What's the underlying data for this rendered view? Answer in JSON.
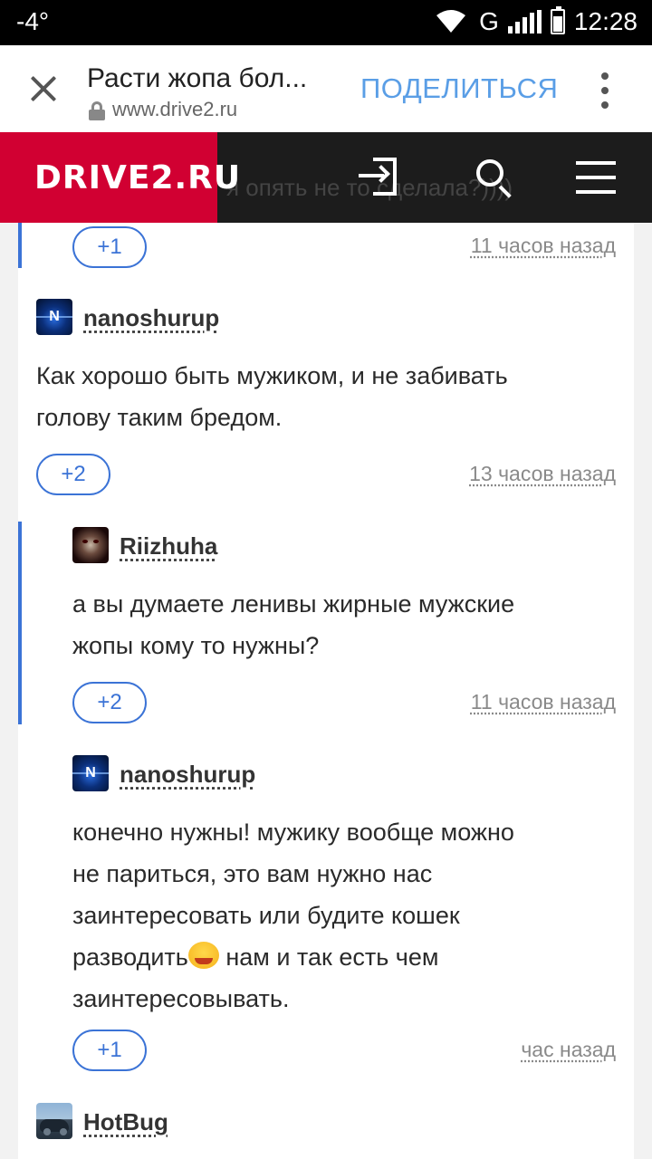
{
  "status_bar": {
    "temperature": "-4°",
    "network": "G",
    "time": "12:28"
  },
  "tab_bar": {
    "title": "Расти жопа бол...",
    "url": "www.drive2.ru",
    "share_label": "ПОДЕЛИТЬСЯ"
  },
  "site_header": {
    "logo": "DRIVE2.RU",
    "behind_text": "я опять не то сделала?))))"
  },
  "comments": [
    {
      "vote": "+1",
      "time": "11 часов назад"
    },
    {
      "author": "nanoshurup",
      "lines": [
        "Как хорошо быть мужиком, и не забивать",
        "голову таким бредом."
      ],
      "vote": "+2",
      "time": "13 часов назад"
    },
    {
      "author": "Riizhuha",
      "lines": [
        "а вы думаете ленивы жирные мужские",
        "жопы кому то нужны?"
      ],
      "vote": "+2",
      "time": "11 часов назад"
    },
    {
      "author": "nanoshurup",
      "lines": [
        "конечно нужны! мужику вообще можно",
        "не париться, это вам нужно нас",
        "заинтересовать или будите кошек",
        "разводить",
        " нам и так есть чем",
        "заинтересовывать."
      ],
      "vote": "+1",
      "time": "час назад"
    },
    {
      "author": "HotBug"
    }
  ],
  "icons": {
    "close": "close-icon",
    "lock": "lock-icon",
    "more": "more-vert-icon",
    "login": "login-icon",
    "search": "search-icon",
    "menu": "hamburger-menu-icon",
    "emoji": "laughing-emoji-icon"
  }
}
